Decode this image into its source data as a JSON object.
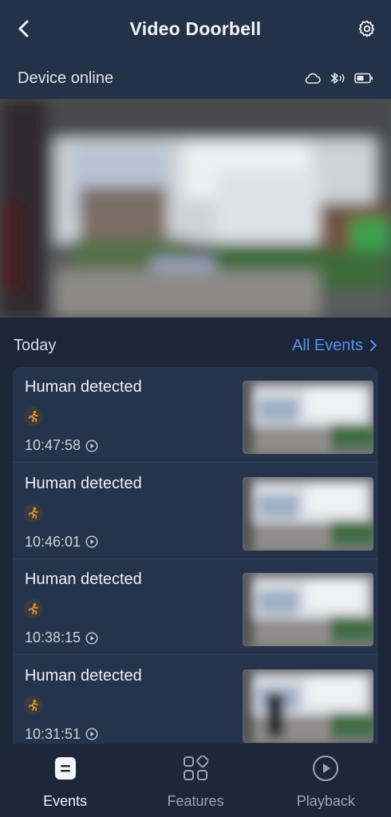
{
  "header": {
    "title": "Video Doorbell",
    "back_icon": "chevron-left-icon",
    "settings_icon": "gear-icon"
  },
  "status": {
    "text": "Device online",
    "icons": [
      "cloud-icon",
      "bluetooth-icon",
      "battery-icon"
    ]
  },
  "section": {
    "title": "Today",
    "all_events_label": "All Events"
  },
  "events": [
    {
      "title": "Human detected",
      "time": "10:47:58",
      "icon": "running-person-icon"
    },
    {
      "title": "Human detected",
      "time": "10:46:01",
      "icon": "running-person-icon"
    },
    {
      "title": "Human detected",
      "time": "10:38:15",
      "icon": "running-person-icon"
    },
    {
      "title": "Human detected",
      "time": "10:31:51",
      "icon": "running-person-icon"
    }
  ],
  "bottom_nav": {
    "tabs": [
      {
        "label": "Events",
        "icon": "events-icon",
        "active": true
      },
      {
        "label": "Features",
        "icon": "features-grid-icon",
        "active": false
      },
      {
        "label": "Playback",
        "icon": "play-circle-icon",
        "active": false
      }
    ]
  },
  "colors": {
    "background": "#1b2638",
    "header": "#243247",
    "card": "#26344b",
    "accent_link": "#5b8ff0",
    "badge_orange": "#f0922a"
  }
}
